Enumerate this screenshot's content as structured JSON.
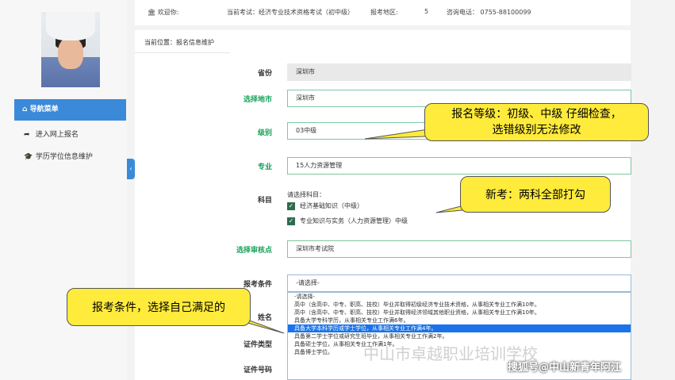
{
  "topbar": {
    "welcome": "欢迎你:",
    "exam": "当前考试：经济专业技术资格考试（初中级）",
    "region_label": "报考地区:",
    "region_value": "5",
    "phone": "咨询电话： 0755-88100099"
  },
  "sidebar": {
    "nav_title": "导航菜单",
    "items": [
      {
        "label": "进入网上报名",
        "icon": "share-icon"
      },
      {
        "label": "学历学位信息维护",
        "icon": "graduation-cap-icon"
      }
    ]
  },
  "breadcrumb": "当前位置：报名信息维护",
  "form": {
    "province_label": "省份",
    "province_value": "深圳市",
    "city_label": "选择地市",
    "city_value": "深圳市",
    "level_label": "级别",
    "level_value": "03中级",
    "major_label": "专业",
    "major_value": "15人力资源管理",
    "subjects_label": "科目",
    "subjects_hint": "请选择科目：",
    "subject_1": "经济基础知识（中级）",
    "subject_2": "专业知识与实务（人力资源管理）中级",
    "audit_label": "选择审核点",
    "audit_value": "深圳市考试院",
    "condition_label": "报考条件",
    "condition_value": "-请选择-",
    "name_label": "姓名",
    "id_type_label": "证件类型",
    "id_no_label": "证件号码"
  },
  "dropdown_options": [
    "-请选择-",
    "高中（含高中、中专、职高、技校）毕业并取得初级经济专业技术资格，从事相关专业工作满10年。",
    "高中（含高中、中专、职高、技校）毕业并取得经济领域其他职业资格，从事相关专业工作满10年。",
    "具备大学专科学历，从事相关专业工作满6年。",
    "具备大学本科学历或学士学位，从事相关专业工作满4年。",
    "具备第二学士学位或研究生班毕业，从事相关专业工作满2年。",
    "具备硕士学位，从事相关专业工作满1年。",
    "具备博士学位。"
  ],
  "selected_option_index": 4,
  "callouts": {
    "level": "报名等级：初级、中级 仔细检查，选错级别无法修改",
    "subjects": "新考：两科全部打勾",
    "condition": "报考条件，选择自己满足的"
  },
  "watermark": "中山市卓越职业培训学校",
  "sohu_mark": "搜狐号@中山新青年阿江",
  "colors": {
    "accent": "#3b8ad9",
    "green_label": "#19a15b",
    "callout": "#ffeb3b",
    "selected": "#1a73e8"
  }
}
